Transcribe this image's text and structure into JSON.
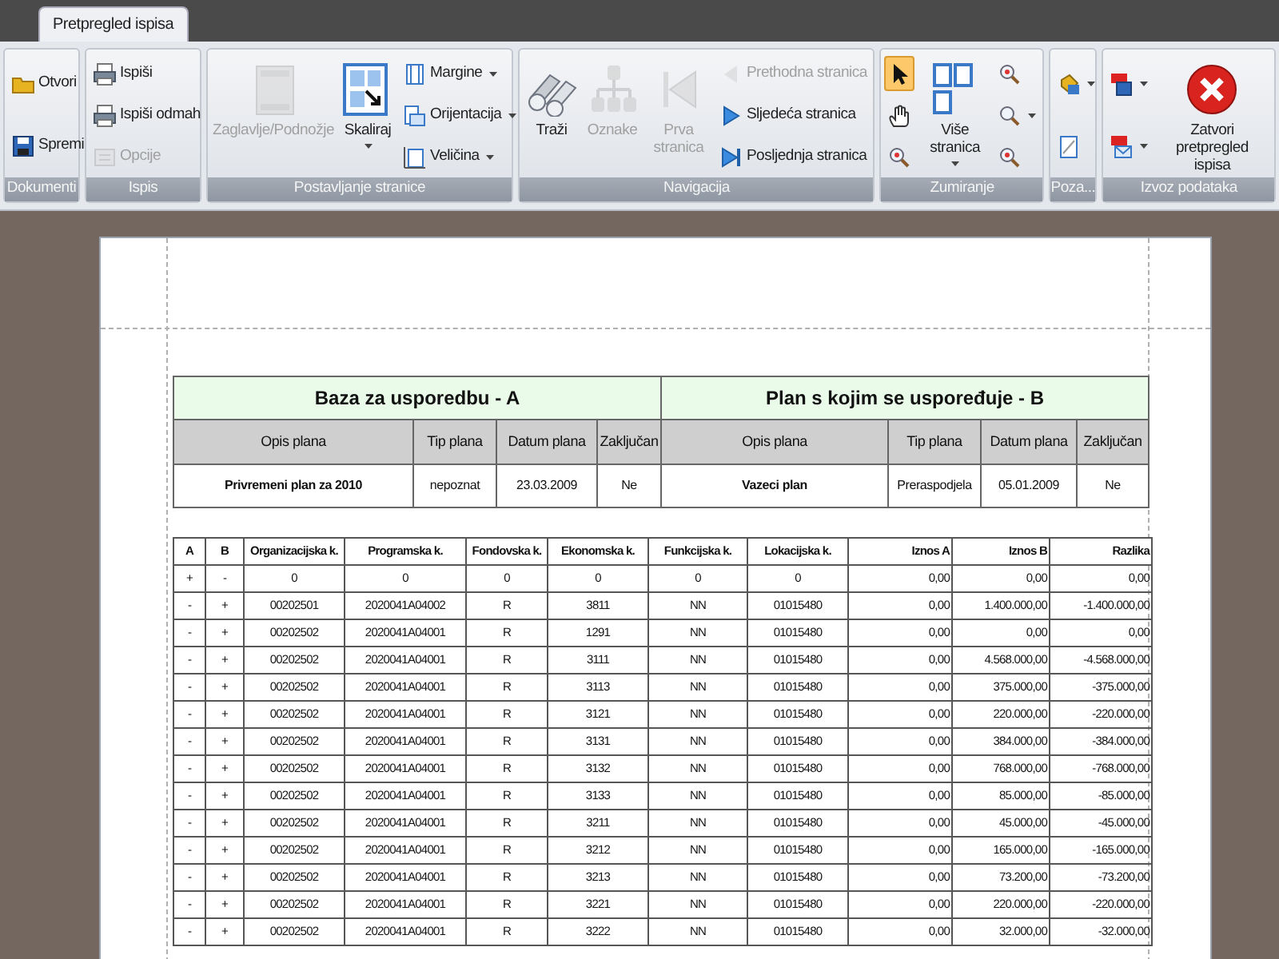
{
  "tab": {
    "label": "Pretpregled ispisa",
    "selected": true
  },
  "ribbon": {
    "groups": [
      {
        "label": "Dokumenti",
        "items": [
          {
            "label": "Otvori",
            "kind": "small",
            "disabled": false
          },
          {
            "label": "Spremi",
            "kind": "small",
            "disabled": false
          }
        ]
      },
      {
        "label": "Ispis",
        "items": [
          {
            "label": "Ispiši",
            "kind": "small",
            "disabled": false
          },
          {
            "label": "Ispiši odmah",
            "kind": "small",
            "disabled": false
          },
          {
            "label": "Opcije",
            "kind": "small",
            "disabled": true
          }
        ]
      },
      {
        "label": "Postavljanje stranice",
        "items": [
          {
            "label": "Zaglavlje/Podnožje",
            "kind": "large",
            "disabled": true
          },
          {
            "label": "Skaliraj",
            "kind": "large",
            "disabled": false,
            "dropdown": true
          },
          {
            "label": "Margine",
            "kind": "small",
            "disabled": false,
            "dropdown": true
          },
          {
            "label": "Orijentacija",
            "kind": "small",
            "disabled": false,
            "dropdown": true
          },
          {
            "label": "Veličina",
            "kind": "small",
            "disabled": false,
            "dropdown": true
          }
        ]
      },
      {
        "label": "Navigacija",
        "items": [
          {
            "label": "Traži",
            "kind": "large",
            "disabled": false
          },
          {
            "label": "Oznake",
            "kind": "large",
            "disabled": true
          },
          {
            "label": "Prva stranica",
            "kind": "large",
            "disabled": true
          },
          {
            "label": "Prethodna stranica",
            "kind": "small",
            "disabled": true
          },
          {
            "label": "Sljedeća stranica",
            "kind": "small",
            "disabled": false
          },
          {
            "label": "Posljednja stranica",
            "kind": "small",
            "disabled": false
          }
        ]
      },
      {
        "label": "Zumiranje",
        "items": [
          {
            "kind": "small",
            "disabled": false,
            "selected": true
          },
          {
            "kind": "small",
            "disabled": false,
            "selected": false
          },
          {
            "kind": "small",
            "disabled": false,
            "selected": false
          },
          {
            "label": "Više stranica",
            "kind": "large",
            "disabled": false,
            "dropdown": true
          },
          {
            "kind": "small",
            "disabled": false
          },
          {
            "kind": "small",
            "disabled": false,
            "dropdown": true
          },
          {
            "kind": "small",
            "disabled": false
          }
        ]
      },
      {
        "label": "Poza...",
        "items": [
          {
            "kind": "small",
            "disabled": false,
            "dropdown": true
          },
          {
            "kind": "small",
            "disabled": false
          }
        ]
      },
      {
        "label": "Izvoz podataka",
        "items": [
          {
            "kind": "small",
            "disabled": false,
            "dropdown": true
          },
          {
            "kind": "small",
            "disabled": false,
            "dropdown": true
          },
          {
            "label": "Zatvori pretpregled ispisa",
            "kind": "large",
            "disabled": false
          }
        ]
      }
    ]
  },
  "summary": {
    "sections": [
      "Baza za usporedbu - A",
      "Plan s kojim se uspoređuje - B"
    ],
    "columns": [
      "Opis plana",
      "Tip plana",
      "Datum plana",
      "Zaključan",
      "Opis plana",
      "Tip plana",
      "Datum plana",
      "Zaključan"
    ],
    "row": [
      "Privremeni plan za 2010",
      "nepoznat",
      "23.03.2009",
      "Ne",
      "Vazeci plan",
      "Preraspodjela",
      "05.01.2009",
      "Ne"
    ]
  },
  "table": {
    "columns": [
      "A",
      "B",
      "Organizacijska k.",
      "Programska k.",
      "Fondovska k.",
      "Ekonomska k.",
      "Funkcijska k.",
      "Lokacijska k.",
      "Iznos A",
      "Iznos B",
      "Razlika"
    ],
    "rows": [
      [
        "+",
        "-",
        "0",
        "0",
        "0",
        "0",
        "0",
        "0",
        "0,00",
        "0,00",
        "0,00"
      ],
      [
        "-",
        "+",
        "00202501",
        "2020041A04002",
        "R",
        "3811",
        "NN",
        "01015480",
        "0,00",
        "1.400.000,00",
        "-1.400.000,00"
      ],
      [
        "-",
        "+",
        "00202502",
        "2020041A04001",
        "R",
        "1291",
        "NN",
        "01015480",
        "0,00",
        "0,00",
        "0,00"
      ],
      [
        "-",
        "+",
        "00202502",
        "2020041A04001",
        "R",
        "3111",
        "NN",
        "01015480",
        "0,00",
        "4.568.000,00",
        "-4.568.000,00"
      ],
      [
        "-",
        "+",
        "00202502",
        "2020041A04001",
        "R",
        "3113",
        "NN",
        "01015480",
        "0,00",
        "375.000,00",
        "-375.000,00"
      ],
      [
        "-",
        "+",
        "00202502",
        "2020041A04001",
        "R",
        "3121",
        "NN",
        "01015480",
        "0,00",
        "220.000,00",
        "-220.000,00"
      ],
      [
        "-",
        "+",
        "00202502",
        "2020041A04001",
        "R",
        "3131",
        "NN",
        "01015480",
        "0,00",
        "384.000,00",
        "-384.000,00"
      ],
      [
        "-",
        "+",
        "00202502",
        "2020041A04001",
        "R",
        "3132",
        "NN",
        "01015480",
        "0,00",
        "768.000,00",
        "-768.000,00"
      ],
      [
        "-",
        "+",
        "00202502",
        "2020041A04001",
        "R",
        "3133",
        "NN",
        "01015480",
        "0,00",
        "85.000,00",
        "-85.000,00"
      ],
      [
        "-",
        "+",
        "00202502",
        "2020041A04001",
        "R",
        "3211",
        "NN",
        "01015480",
        "0,00",
        "45.000,00",
        "-45.000,00"
      ],
      [
        "-",
        "+",
        "00202502",
        "2020041A04001",
        "R",
        "3212",
        "NN",
        "01015480",
        "0,00",
        "165.000,00",
        "-165.000,00"
      ],
      [
        "-",
        "+",
        "00202502",
        "2020041A04001",
        "R",
        "3213",
        "NN",
        "01015480",
        "0,00",
        "73.200,00",
        "-73.200,00"
      ],
      [
        "-",
        "+",
        "00202502",
        "2020041A04001",
        "R",
        "3221",
        "NN",
        "01015480",
        "0,00",
        "220.000,00",
        "-220.000,00"
      ],
      [
        "-",
        "+",
        "00202502",
        "2020041A04001",
        "R",
        "3222",
        "NN",
        "01015480",
        "0,00",
        "32.000,00",
        "-32.000,00"
      ]
    ]
  }
}
